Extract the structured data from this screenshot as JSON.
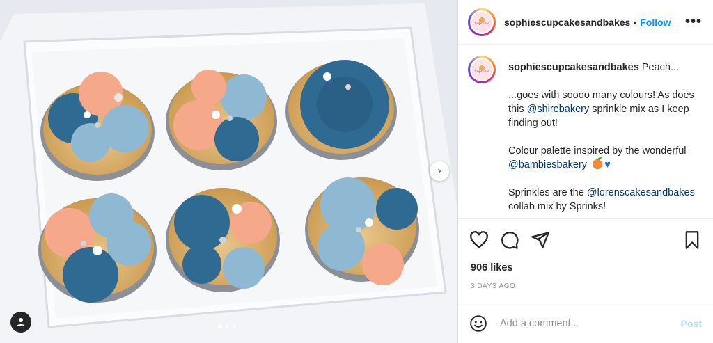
{
  "post": {
    "username": "sophiescupcakesandbakes",
    "follow_label": "Follow",
    "more_label": "•••",
    "caption": {
      "username": "sophiescupcakesandbakes",
      "headline": "Peach...",
      "p1": "...goes with soooo many colours! As does this ",
      "p1_mention": "@shirebakery",
      "p1_end": " sprinkle mix as I keep finding out!",
      "p2": "Colour palette inspired by the wonderful ",
      "p2_mention": "@bambiesbakery",
      "p3": "Sprinkles are the ",
      "p3_mention": "@lorenscakesandbakes",
      "p3_end": " collab mix by Sprinks!"
    },
    "likes": "906 likes",
    "timestamp": "3 DAYS AGO",
    "comment_placeholder": "Add a comment...",
    "post_label": "Post",
    "carousel": {
      "slide_count": 3,
      "active_index": 0
    },
    "avatar_text": "Sophie's"
  },
  "icons": {
    "like": "heart-icon",
    "comment": "comment-icon",
    "share": "share-icon",
    "save": "bookmark-icon",
    "emoji": "emoji-icon",
    "user_tag": "user-tag-icon",
    "next": "chevron-right-icon"
  },
  "colors": {
    "follow": "#0095f6",
    "mention": "#00376b",
    "post_disabled": "#b3dbff",
    "frosting_blue": "#2f6a93",
    "frosting_lightblue": "#8fb9d3",
    "frosting_peach": "#f6a98a"
  }
}
